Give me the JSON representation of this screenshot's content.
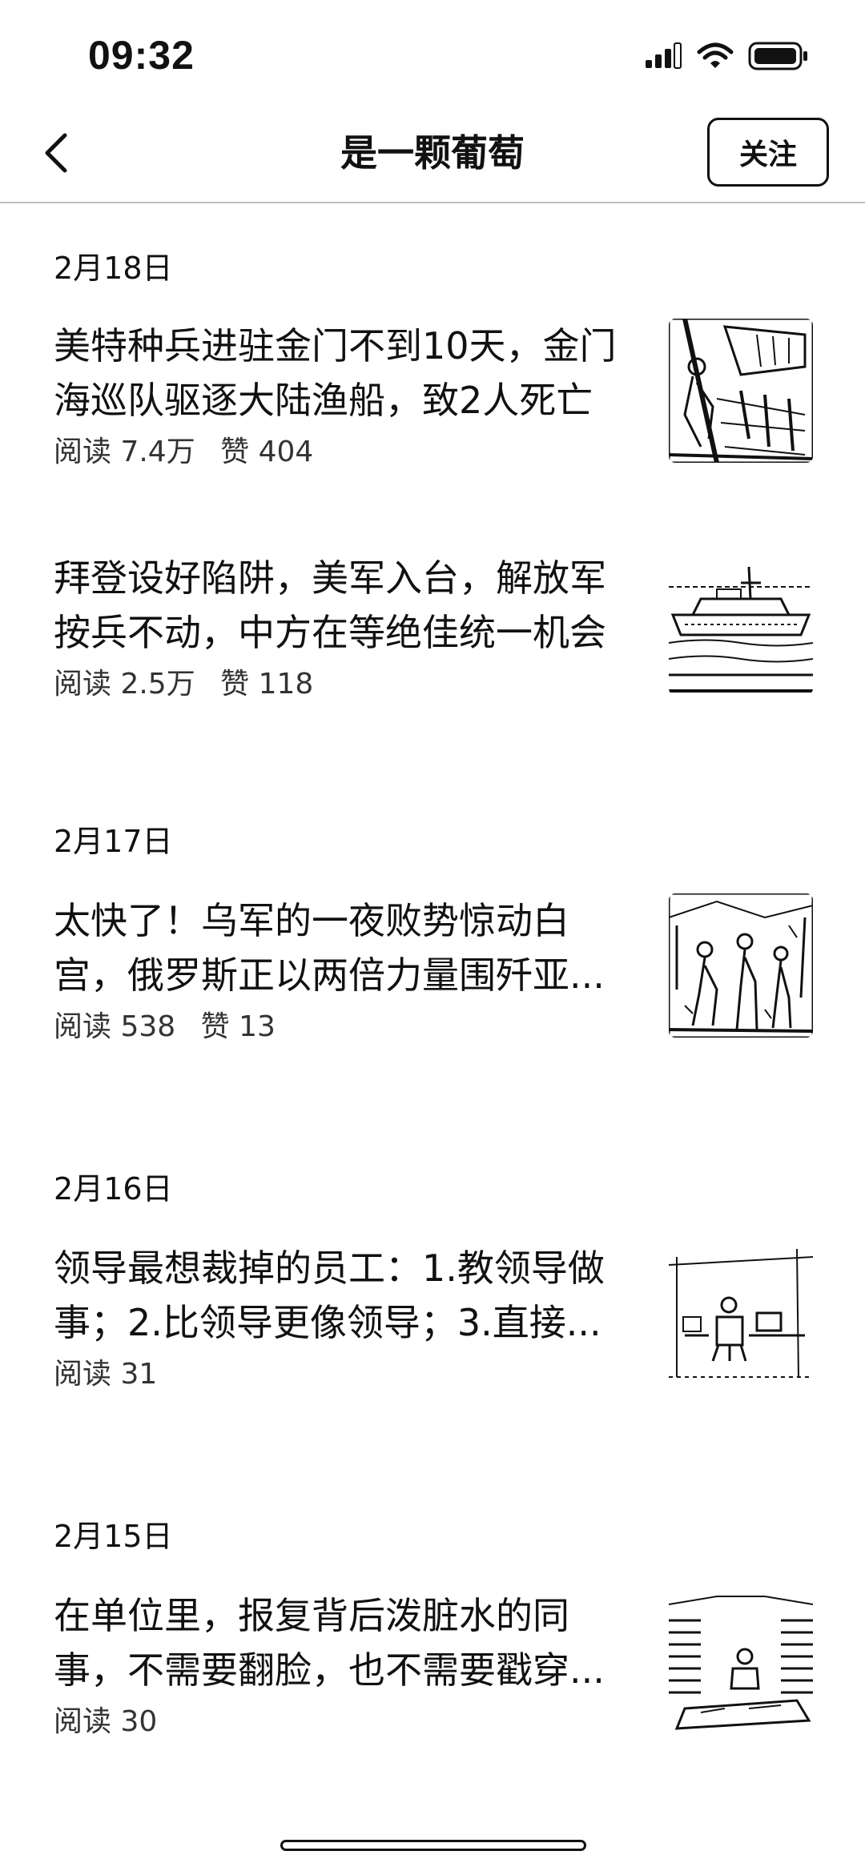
{
  "status_bar": {
    "time": "09:32",
    "icons": [
      "signal-icon",
      "wifi-icon",
      "battery-icon"
    ]
  },
  "nav": {
    "back_icon": "chevron-left-icon",
    "title": "是一颗葡萄",
    "follow_label": "关注"
  },
  "feed": [
    {
      "date": "2月18日",
      "articles": [
        {
          "title_lines": [
            "美特种兵进驻金门不到10天，金门",
            "海巡队驱逐大陆渔船，致2人死亡"
          ],
          "reads": "阅读 7.4万",
          "likes": "赞 404",
          "thumb": "soldiers-on-boat-image"
        },
        {
          "title_lines": [
            "拜登设好陷阱，美军入台，解放军",
            "按兵不动，中方在等绝佳统一机会"
          ],
          "reads": "阅读 2.5万",
          "likes": "赞 118",
          "thumb": "warship-image"
        }
      ]
    },
    {
      "date": "2月17日",
      "articles": [
        {
          "title_lines": [
            "太快了！乌军的一夜败势惊动白",
            "宫，俄罗斯正以两倍力量围歼亚..."
          ],
          "reads": "阅读 538",
          "likes": "赞 13",
          "thumb": "soldiers-street-image"
        }
      ]
    },
    {
      "date": "2月16日",
      "articles": [
        {
          "title_lines": [
            "领导最想裁掉的员工：1.教领导做",
            "事；2.比领导更像领导；3.直接..."
          ],
          "reads": "阅读 31",
          "likes": "",
          "thumb": "office-desk-image"
        }
      ]
    },
    {
      "date": "2月15日",
      "articles": [
        {
          "title_lines": [
            "在单位里，报复背后泼脏水的同",
            "事，不需要翻脸，也不需要戳穿..."
          ],
          "reads": "阅读 30",
          "likes": "",
          "thumb": "paper-piles-office-image"
        }
      ]
    }
  ]
}
